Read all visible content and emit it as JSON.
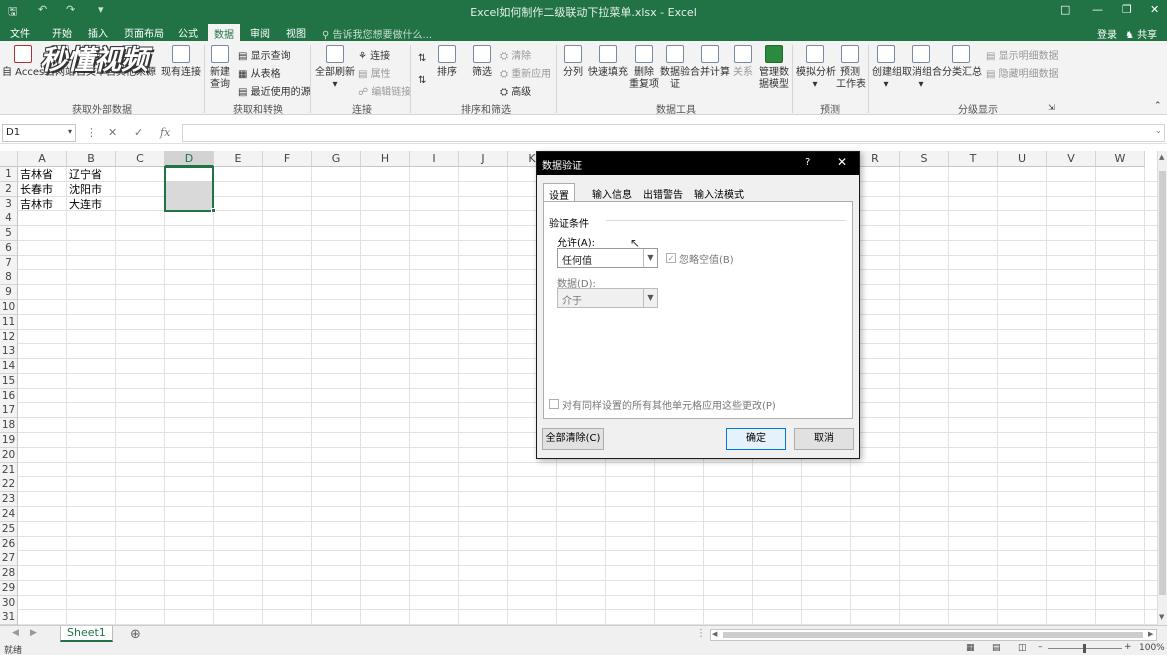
{
  "window": {
    "title": "Excel如何制作二级联动下拉菜单.xlsx - Excel",
    "quick_access": [
      "↶",
      "↷",
      "▾"
    ]
  },
  "menu": {
    "tabs": [
      "文件",
      "开始",
      "插入",
      "页面布局",
      "公式",
      "数据",
      "审阅",
      "视图"
    ],
    "active": "数据",
    "tellme": "告诉我您想要做什么...",
    "login": "登录",
    "share": "共享"
  },
  "watermark": "秒懂视频",
  "ribbon": {
    "ext": {
      "access": "自 Access",
      "web": "自网站",
      "text": "自文本",
      "other": "自其他来源",
      "existing": "现有连接",
      "group": "获取外部数据"
    },
    "transform": {
      "new_query": "新建",
      "new_query2": "查询",
      "show_query": "显示查询",
      "from_table": "从表格",
      "recent": "最近使用的源",
      "group": "获取和转换"
    },
    "conn": {
      "refresh_all": "全部刷新",
      "connections": "连接",
      "properties": "属性",
      "edit_links": "编辑链接",
      "group": "连接"
    },
    "sort": {
      "sort": "排序",
      "filter": "筛选",
      "clear": "清除",
      "reapply": "重新应用",
      "advanced": "高级",
      "group": "排序和筛选"
    },
    "tools": {
      "split": "分列",
      "flash_fill": "快速填充",
      "remove_dup": "删除",
      "remove_dup2": "重复项",
      "validation": "数据验",
      "validation2": "证",
      "consolidate": "合并计算",
      "relations": "关系",
      "model": "管理数",
      "model2": "据模型",
      "group": "数据工具"
    },
    "forecast": {
      "whatif": "模拟分析",
      "sheet": "预测",
      "sheet2": "工作表",
      "group": "预测"
    },
    "outline": {
      "group_btn": "创建组",
      "ungroup": "取消组合",
      "subtotal": "分类汇总",
      "show_detail": "显示明细数据",
      "hide_detail": "隐藏明细数据",
      "group": "分级显示"
    }
  },
  "formula_bar": {
    "name_box": "D1",
    "fx": "fx",
    "content": ""
  },
  "grid": {
    "columns": [
      "A",
      "B",
      "C",
      "D",
      "E",
      "F",
      "G",
      "H",
      "I",
      "J",
      "K",
      "L",
      "M",
      "N",
      "O",
      "P",
      "Q",
      "R",
      "S",
      "T",
      "U",
      "V",
      "W"
    ],
    "rows": [
      "1",
      "2",
      "3",
      "4",
      "5",
      "6",
      "7",
      "8",
      "9",
      "10",
      "11",
      "12",
      "13",
      "14",
      "15",
      "16",
      "17",
      "18",
      "19",
      "20",
      "21",
      "22",
      "23",
      "24",
      "25",
      "26",
      "27",
      "28",
      "29",
      "30",
      "31"
    ],
    "cells": {
      "A1": "吉林省",
      "B1": "辽宁省",
      "A2": "长春市",
      "B2": "沈阳市",
      "A3": "吉林市",
      "B3": "大连市"
    }
  },
  "sheet_tab": "Sheet1",
  "status": {
    "ready": "就绪",
    "zoom": "100%"
  },
  "dialog": {
    "title": "数据验证",
    "help": "?",
    "close": "✕",
    "tabs": [
      "设置",
      "输入信息",
      "出错警告",
      "输入法模式"
    ],
    "section": "验证条件",
    "allow_label": "允许(A):",
    "allow_value": "任何值",
    "ignore_blank": "忽略空值(B)",
    "data_label": "数据(D):",
    "data_value": "介于",
    "apply_all": "对有同样设置的所有其他单元格应用这些更改(P)",
    "clear_all": "全部清除(C)",
    "ok": "确定",
    "cancel": "取消"
  }
}
